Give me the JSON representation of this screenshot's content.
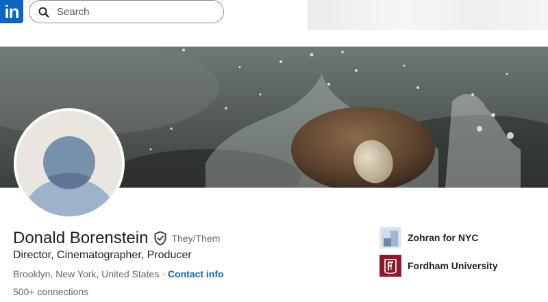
{
  "nav": {
    "logo_text": "in",
    "search_placeholder": "Search"
  },
  "profile": {
    "name": "Donald Borenstein",
    "pronouns": "They/Them",
    "headline": "Director, Cinematographer, Producer",
    "location": "Brooklyn, New York, United States",
    "separator": "·",
    "contact_label": "Contact info",
    "connections": "500+ connections"
  },
  "organizations": [
    {
      "name": "Zohran for NYC",
      "icon": "campaign-logo"
    },
    {
      "name": "Fordham University",
      "icon": "fordham-logo"
    }
  ],
  "colors": {
    "brand": "#0a66c2",
    "fordham_maroon": "#8b1a2b",
    "text_primary": "#1f1f1f",
    "text_secondary": "#666666"
  }
}
